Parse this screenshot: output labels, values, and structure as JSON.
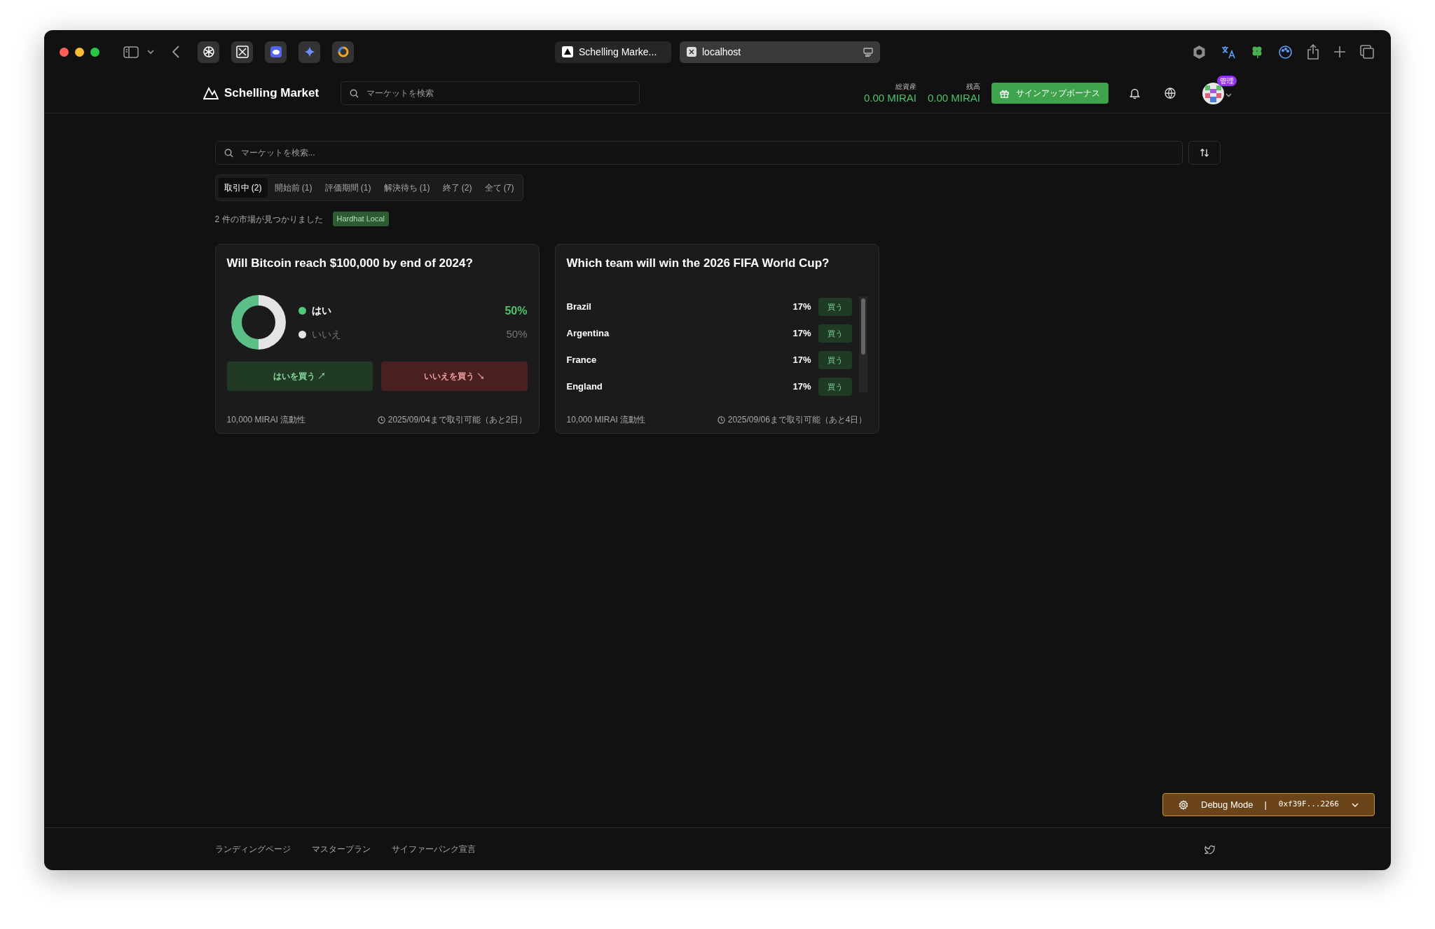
{
  "browser": {
    "tabs": [
      {
        "label": "Schelling Marke...",
        "selected": false
      },
      {
        "label": "localhost",
        "selected": true
      }
    ]
  },
  "header": {
    "brand": "Schelling Market",
    "search_placeholder": "マーケットを検索",
    "balances": [
      {
        "label": "総資産",
        "value": "0.00 MIRAI"
      },
      {
        "label": "残高",
        "value": "0.00 MIRAI"
      }
    ],
    "bonus_button": "サインアップボーナス",
    "admin_badge": "管理"
  },
  "search": {
    "placeholder": "マーケットを検索..."
  },
  "tabs": [
    {
      "label": "取引中 (2)",
      "selected": true
    },
    {
      "label": "開始前 (1)",
      "selected": false
    },
    {
      "label": "評価期間 (1)",
      "selected": false
    },
    {
      "label": "解決待ち (1)",
      "selected": false
    },
    {
      "label": "終了 (2)",
      "selected": false
    },
    {
      "label": "全て (7)",
      "selected": false
    }
  ],
  "result_count": "2 件の市場が見つかりました",
  "network_badge": "Hardhat Local",
  "markets": [
    {
      "kind": "binary",
      "title": "Will Bitcoin reach $100,000 by end of 2024?",
      "outcomes": [
        {
          "kind": "yes",
          "label": "はい",
          "percent": "50%",
          "level": 0.5,
          "color": "#4ec97a"
        },
        {
          "kind": "no",
          "label": "いいえ",
          "percent": "50%",
          "level": 0.5,
          "color": "#e4e4e7"
        }
      ],
      "buttons": [
        {
          "kind": "yes",
          "label": "はいを買う ↗"
        },
        {
          "kind": "no",
          "label": "いいえを買う ↘"
        }
      ],
      "liquidity": "10,000 MIRAI 流動性",
      "deadline": "2025/09/04まで取引可能（あと2日）"
    },
    {
      "kind": "multi",
      "title": "Which team will win the 2026 FIFA World Cup?",
      "outcomes": [
        {
          "label": "Brazil",
          "percent": "17%",
          "button": "買う"
        },
        {
          "label": "Argentina",
          "percent": "17%",
          "button": "買う"
        },
        {
          "label": "France",
          "percent": "17%",
          "button": "買う"
        },
        {
          "label": "England",
          "percent": "17%",
          "button": "買う"
        }
      ],
      "liquidity": "10,000 MIRAI 流動性",
      "deadline": "2025/09/06まで取引可能（あと4日）"
    }
  ],
  "debug": {
    "label": "Debug Mode",
    "separator": "|",
    "address": "0xf39F...2266"
  },
  "footer_links": [
    "ランディングページ",
    "マスタープラン",
    "サイファーパンク宣言"
  ]
}
